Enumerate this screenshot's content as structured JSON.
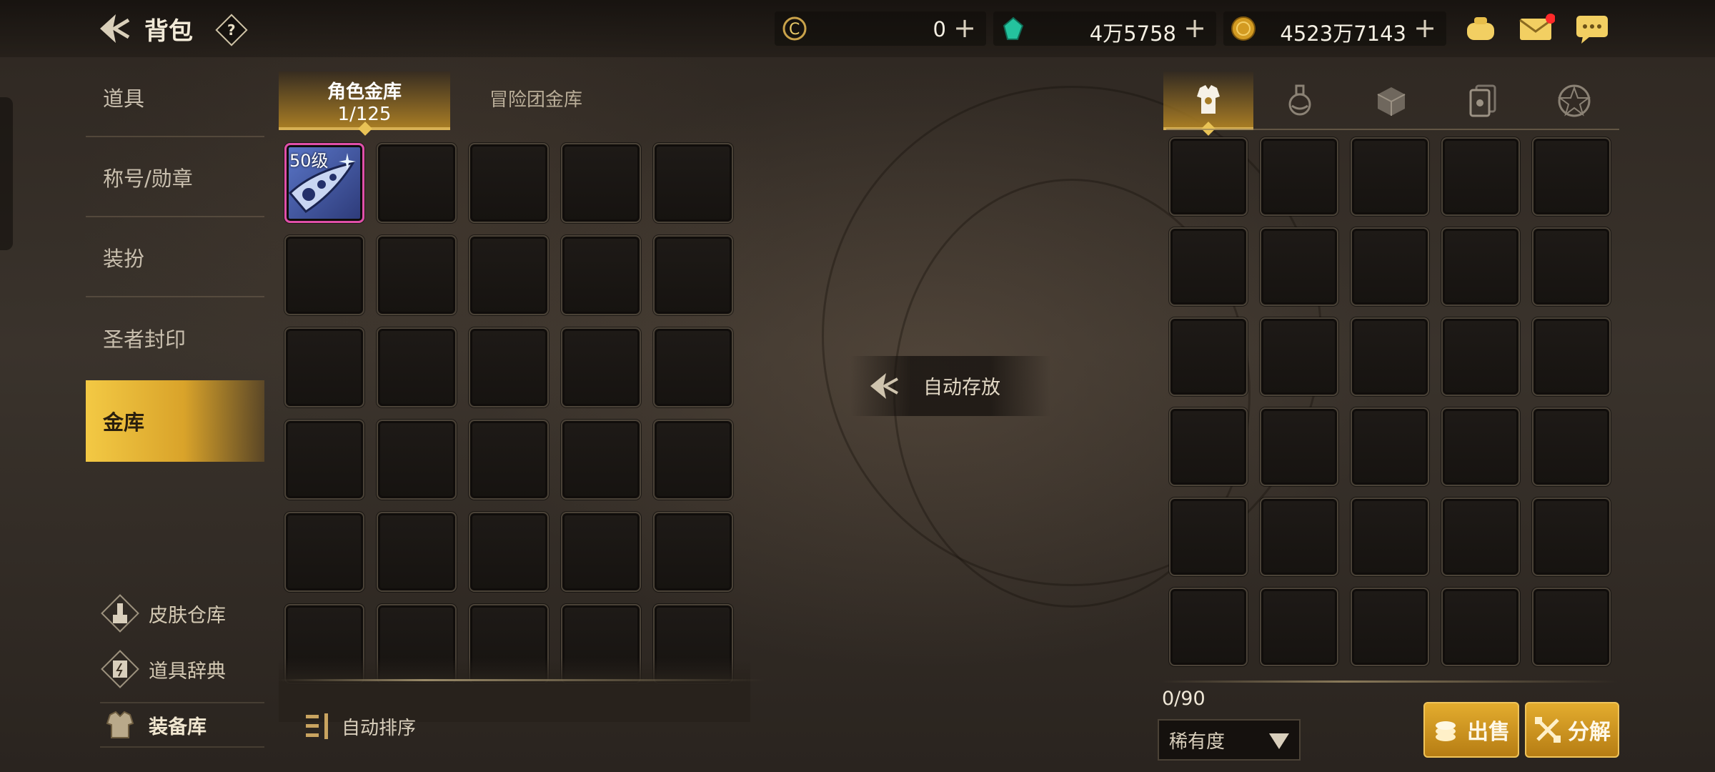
{
  "header": {
    "title": "背包",
    "help_label": "?"
  },
  "currencies": [
    {
      "name": "c-coin",
      "value": "0",
      "plus": "+"
    },
    {
      "name": "green-gem",
      "value": "4万5758",
      "plus": "+"
    },
    {
      "name": "gold-coin",
      "value": "4523万7143",
      "plus": "+"
    }
  ],
  "top_icons": [
    "pouch-icon",
    "mail-icon",
    "chat-icon"
  ],
  "colors": {
    "accent": "#d7a32b",
    "rarity_border": "#e04fa8",
    "notify_dot": "#ff2a2a"
  },
  "sidebar": {
    "items": [
      {
        "label": "道具"
      },
      {
        "label": "称号/勋章"
      },
      {
        "label": "装扮"
      },
      {
        "label": "圣者封印"
      },
      {
        "label": "金库",
        "active": true
      }
    ],
    "links": [
      {
        "label": "皮肤仓库",
        "icon": "brush-icon"
      },
      {
        "label": "道具辞典",
        "icon": "book-icon"
      },
      {
        "label": "装备库",
        "icon": "armor-icon"
      }
    ]
  },
  "vault": {
    "tabs": [
      {
        "label": "角色金库",
        "sub": "1/125",
        "active": true
      },
      {
        "label": "冒险团金库"
      }
    ],
    "items": [
      {
        "level": "50级",
        "rarity": "pink"
      }
    ],
    "sort_label": "自动排序"
  },
  "auto_store": {
    "label": "自动存放"
  },
  "inventory": {
    "tabs": [
      "equipment-icon",
      "potion-icon",
      "materials-icon",
      "cards-icon",
      "emblem-icon"
    ],
    "count": "0/90",
    "sort_select": "稀有度",
    "sell_label": "出售",
    "decompose_label": "分解"
  }
}
